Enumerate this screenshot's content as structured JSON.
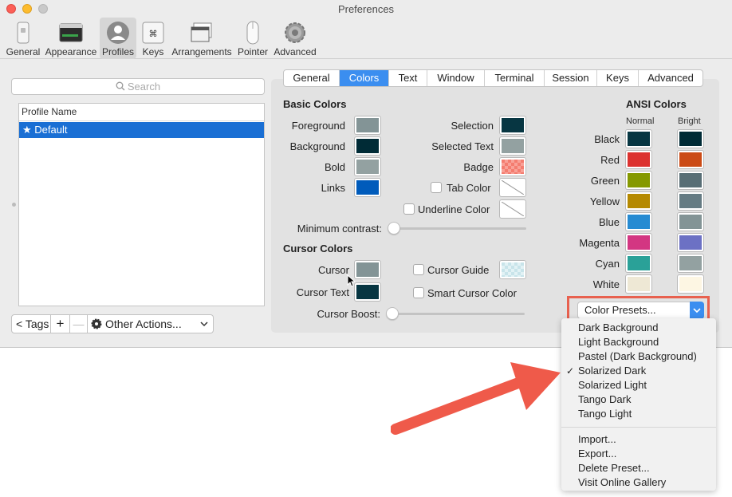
{
  "window": {
    "title": "Preferences"
  },
  "toolbar": {
    "items": [
      {
        "label": "General",
        "icon": "switch-icon"
      },
      {
        "label": "Appearance",
        "icon": "window-icon"
      },
      {
        "label": "Profiles",
        "icon": "user-icon",
        "selected": true
      },
      {
        "label": "Keys",
        "icon": "command-key-icon"
      },
      {
        "label": "Arrangements",
        "icon": "arrangements-icon"
      },
      {
        "label": "Pointer",
        "icon": "mouse-icon"
      },
      {
        "label": "Advanced",
        "icon": "gear-icon"
      }
    ]
  },
  "sidebar": {
    "search_placeholder": "Search",
    "column_header": "Profile Name",
    "profiles": [
      "★ Default"
    ],
    "tags_button": "< Tags",
    "add_button": "+",
    "remove_button": "—",
    "other_actions": "Other Actions..."
  },
  "tabs": [
    "General",
    "Colors",
    "Text",
    "Window",
    "Terminal",
    "Session",
    "Keys",
    "Advanced"
  ],
  "active_tab": "Colors",
  "basic_colors": {
    "title": "Basic Colors",
    "foreground": {
      "label": "Foreground",
      "color": "#839496"
    },
    "background": {
      "label": "Background",
      "color": "#002b36"
    },
    "bold": {
      "label": "Bold",
      "color": "#93a1a1"
    },
    "links": {
      "label": "Links",
      "color": "#005bbb"
    },
    "selection": {
      "label": "Selection",
      "color": "#073642"
    },
    "selected_text": {
      "label": "Selected Text",
      "color": "#93a1a1"
    },
    "badge": {
      "label": "Badge",
      "color": "#f47d70"
    },
    "tab_color": {
      "label": "Tab Color"
    },
    "underline_color": {
      "label": "Underline Color"
    },
    "min_contrast": {
      "label": "Minimum contrast:",
      "value": 0
    }
  },
  "cursor_colors": {
    "title": "Cursor Colors",
    "cursor": {
      "label": "Cursor",
      "color": "#839496"
    },
    "cursor_text": {
      "label": "Cursor Text",
      "color": "#073642"
    },
    "cursor_guide": {
      "label": "Cursor Guide",
      "color": "#c8e4ea"
    },
    "smart_cursor": {
      "label": "Smart Cursor Color"
    },
    "cursor_boost": {
      "label": "Cursor Boost:",
      "value": 0
    }
  },
  "ansi": {
    "title": "ANSI Colors",
    "normal_header": "Normal",
    "bright_header": "Bright",
    "rows": [
      {
        "name": "Black",
        "normal": "#073642",
        "bright": "#002b36"
      },
      {
        "name": "Red",
        "normal": "#dc322f",
        "bright": "#cb4b16"
      },
      {
        "name": "Green",
        "normal": "#859900",
        "bright": "#586e75"
      },
      {
        "name": "Yellow",
        "normal": "#b58900",
        "bright": "#657b83"
      },
      {
        "name": "Blue",
        "normal": "#268bd2",
        "bright": "#839496"
      },
      {
        "name": "Magenta",
        "normal": "#d33682",
        "bright": "#6c71c4"
      },
      {
        "name": "Cyan",
        "normal": "#2aa198",
        "bright": "#93a1a1"
      },
      {
        "name": "White",
        "normal": "#eee8d5",
        "bright": "#fdf6e3"
      }
    ]
  },
  "presets": {
    "button_label": "Color Presets...",
    "items": [
      "Dark Background",
      "Light Background",
      "Pastel (Dark Background)",
      "Solarized Dark",
      "Solarized Light",
      "Tango Dark",
      "Tango Light"
    ],
    "checked": "Solarized Dark",
    "actions": [
      "Import...",
      "Export...",
      "Delete Preset...",
      "Visit Online Gallery"
    ]
  },
  "colors": {
    "accent": "#3b8ef0",
    "highlight_box": "#e8614f",
    "arrow": "#ef5a4a"
  }
}
